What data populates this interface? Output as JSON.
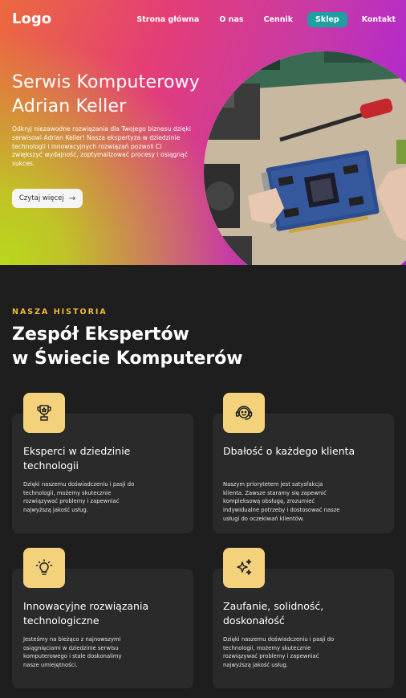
{
  "header": {
    "logo": "Logo",
    "nav": [
      "Strona główna",
      "O nas",
      "Cennik",
      "Sklep",
      "Kontakt"
    ],
    "active_nav": "Sklep"
  },
  "hero": {
    "title": "Serwis Komputerowy Adrian Keller",
    "text": "Odkryj niezawodne rozwiązania dla Twojego biznesu dzięki serwisowi Adrian Keller! Nasza ekspertyza w dziedzinie technologii i innowacyjnych rozwiązań pozwoli Ci zwiększyć wydajność, zoptymalizować procesy i osiągnąć sukces.",
    "button": "Czytaj więcej",
    "button_icon": "arrow-right-icon",
    "image": "photo-hands-repairing-graphics-card"
  },
  "section": {
    "eyebrow": "NASZA HISTORIA",
    "title_line1": "Zespół Ekspertów",
    "title_line2": "w Świecie Komputerów"
  },
  "cards": [
    {
      "icon": "trophy-icon",
      "title": "Eksperci w dziedzinie technologii",
      "text": "Dzięki naszemu doświadczeniu i pasji do technologii, możemy skutecznie rozwiązywać problemy i zapewniać najwyższą jakość usług."
    },
    {
      "icon": "headset-support-icon",
      "title": "Dbałość o każdego klienta",
      "text": "Naszym priorytetem jest satysfakcja klienta. Zawsze staramy się zapewnić kompleksową obsługę, zrozumieć indywidualne potrzeby i dostosować nasze usługi do oczekiwań klientów."
    },
    {
      "icon": "lightbulb-icon",
      "title": "Innowacyjne rozwiązania technologiczne",
      "text": "Jesteśmy na bieżąco z najnowszymi osiągnięciami w dziedzinie serwisu komputerowego i stale doskonalimy nasze umiejętności."
    },
    {
      "icon": "sparkles-icon",
      "title": "Zaufanie, solidność, doskonałość",
      "text": "Dzięki naszemu doświadczeniu i pasji do technologii, możemy skutecznie rozwiązywać problemy i zapewniać najwyższą jakość usług."
    }
  ],
  "colors": {
    "accent_gold": "#f0b93a",
    "icon_bg": "#f4d27c",
    "active_nav_bg": "#1e9fa1",
    "page_bg": "#1e1e1e",
    "card_bg": "#2a2a2a"
  }
}
